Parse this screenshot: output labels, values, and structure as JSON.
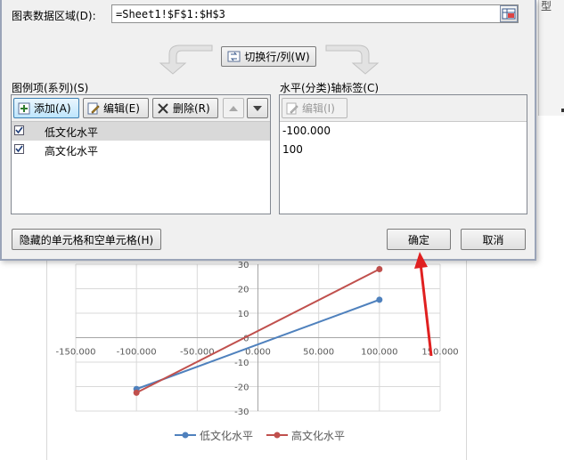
{
  "dialog": {
    "range_label": "图表数据区域(D):",
    "range_value": "=Sheet1!$F$1:$H$3",
    "switch_label": "切换行/列(W)",
    "legend_header": "图例项(系列)(S)",
    "add_label": "添加(A)",
    "edit_label": "编辑(E)",
    "delete_label": "删除(R)",
    "axis_header": "水平(分类)轴标签(C)",
    "axis_edit_label": "编辑(I)",
    "series": [
      {
        "label": "低文化水平",
        "checked": true
      },
      {
        "label": "高文化水平",
        "checked": true
      }
    ],
    "axis_labels": [
      "-100.000",
      "100"
    ],
    "hidden_cells_label": "隐藏的单元格和空单元格(H)",
    "ok_label": "确定",
    "cancel_label": "取消"
  },
  "sheet": {
    "strip_text": "型"
  },
  "chart_data": {
    "type": "line",
    "x_ticks": [
      "-150.000",
      "-100.000",
      "-50.000",
      "0.000",
      "50.000",
      "100.000",
      "150.000"
    ],
    "y_ticks": [
      "30",
      "20",
      "10",
      "0",
      "-10",
      "-20",
      "-30"
    ],
    "xlim": [
      -150,
      150
    ],
    "ylim": [
      -30,
      30
    ],
    "series": [
      {
        "name": "低文化水平",
        "color": "#4f81bd",
        "x": [
          -100,
          100
        ],
        "y": [
          -21,
          15.5
        ]
      },
      {
        "name": "高文化水平",
        "color": "#c0504d",
        "x": [
          -100,
          100
        ],
        "y": [
          -22.5,
          28
        ]
      }
    ],
    "legend_position": "bottom"
  },
  "colors": {
    "annotation": "#e02020"
  }
}
